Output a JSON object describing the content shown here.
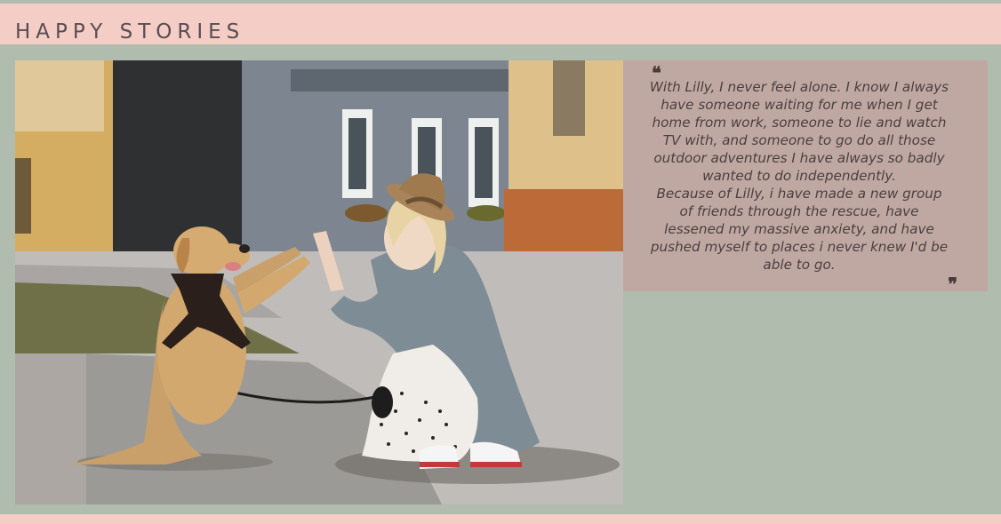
{
  "header": {
    "title": "HAPPY STORIES"
  },
  "story": {
    "photo_icon": "photo-woman-high-five-dog",
    "quote_open_glyph": "❝",
    "quote_close_glyph": "❞",
    "paragraphs": [
      "With Lilly, I never feel alone. I know I always have someone waiting for me when I get home from work, someone to lie and watch TV with, and someone to go do all those outdoor adventures I have always so badly wanted to do independently.",
      "Because of Lilly, i have made a new group of friends through the rescue, have lessened my massive anxiety, and have pushed myself to places i never knew I'd be able to go."
    ]
  },
  "colors": {
    "background": "#afbcae",
    "header_bg": "#f3cdc6",
    "card_bg": "#c0a8a2",
    "text": "#4a3f40"
  }
}
